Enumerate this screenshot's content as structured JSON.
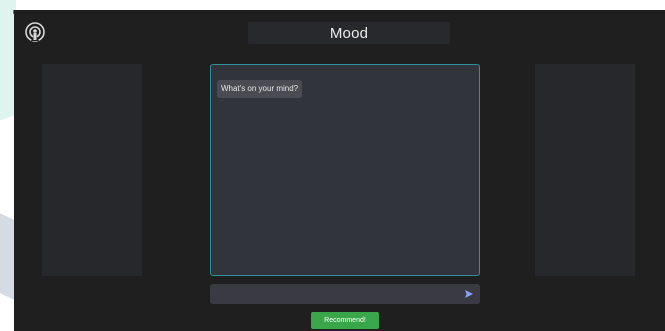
{
  "header": {
    "title": "Mood",
    "brand_icon": "broadcast-icon"
  },
  "chat": {
    "messages": [
      {
        "text": "What's on your mind?"
      }
    ]
  },
  "input": {
    "value": "",
    "placeholder": "",
    "send_icon": "send-icon"
  },
  "actions": {
    "recommend_label": "Recommend!"
  },
  "colors": {
    "background": "#1f1f20",
    "panel": "#27282b",
    "chat_panel": "#32343c",
    "chat_border": "#2f8f9a",
    "accent_send": "#8ea0ff",
    "button_green": "#3aa64a"
  }
}
